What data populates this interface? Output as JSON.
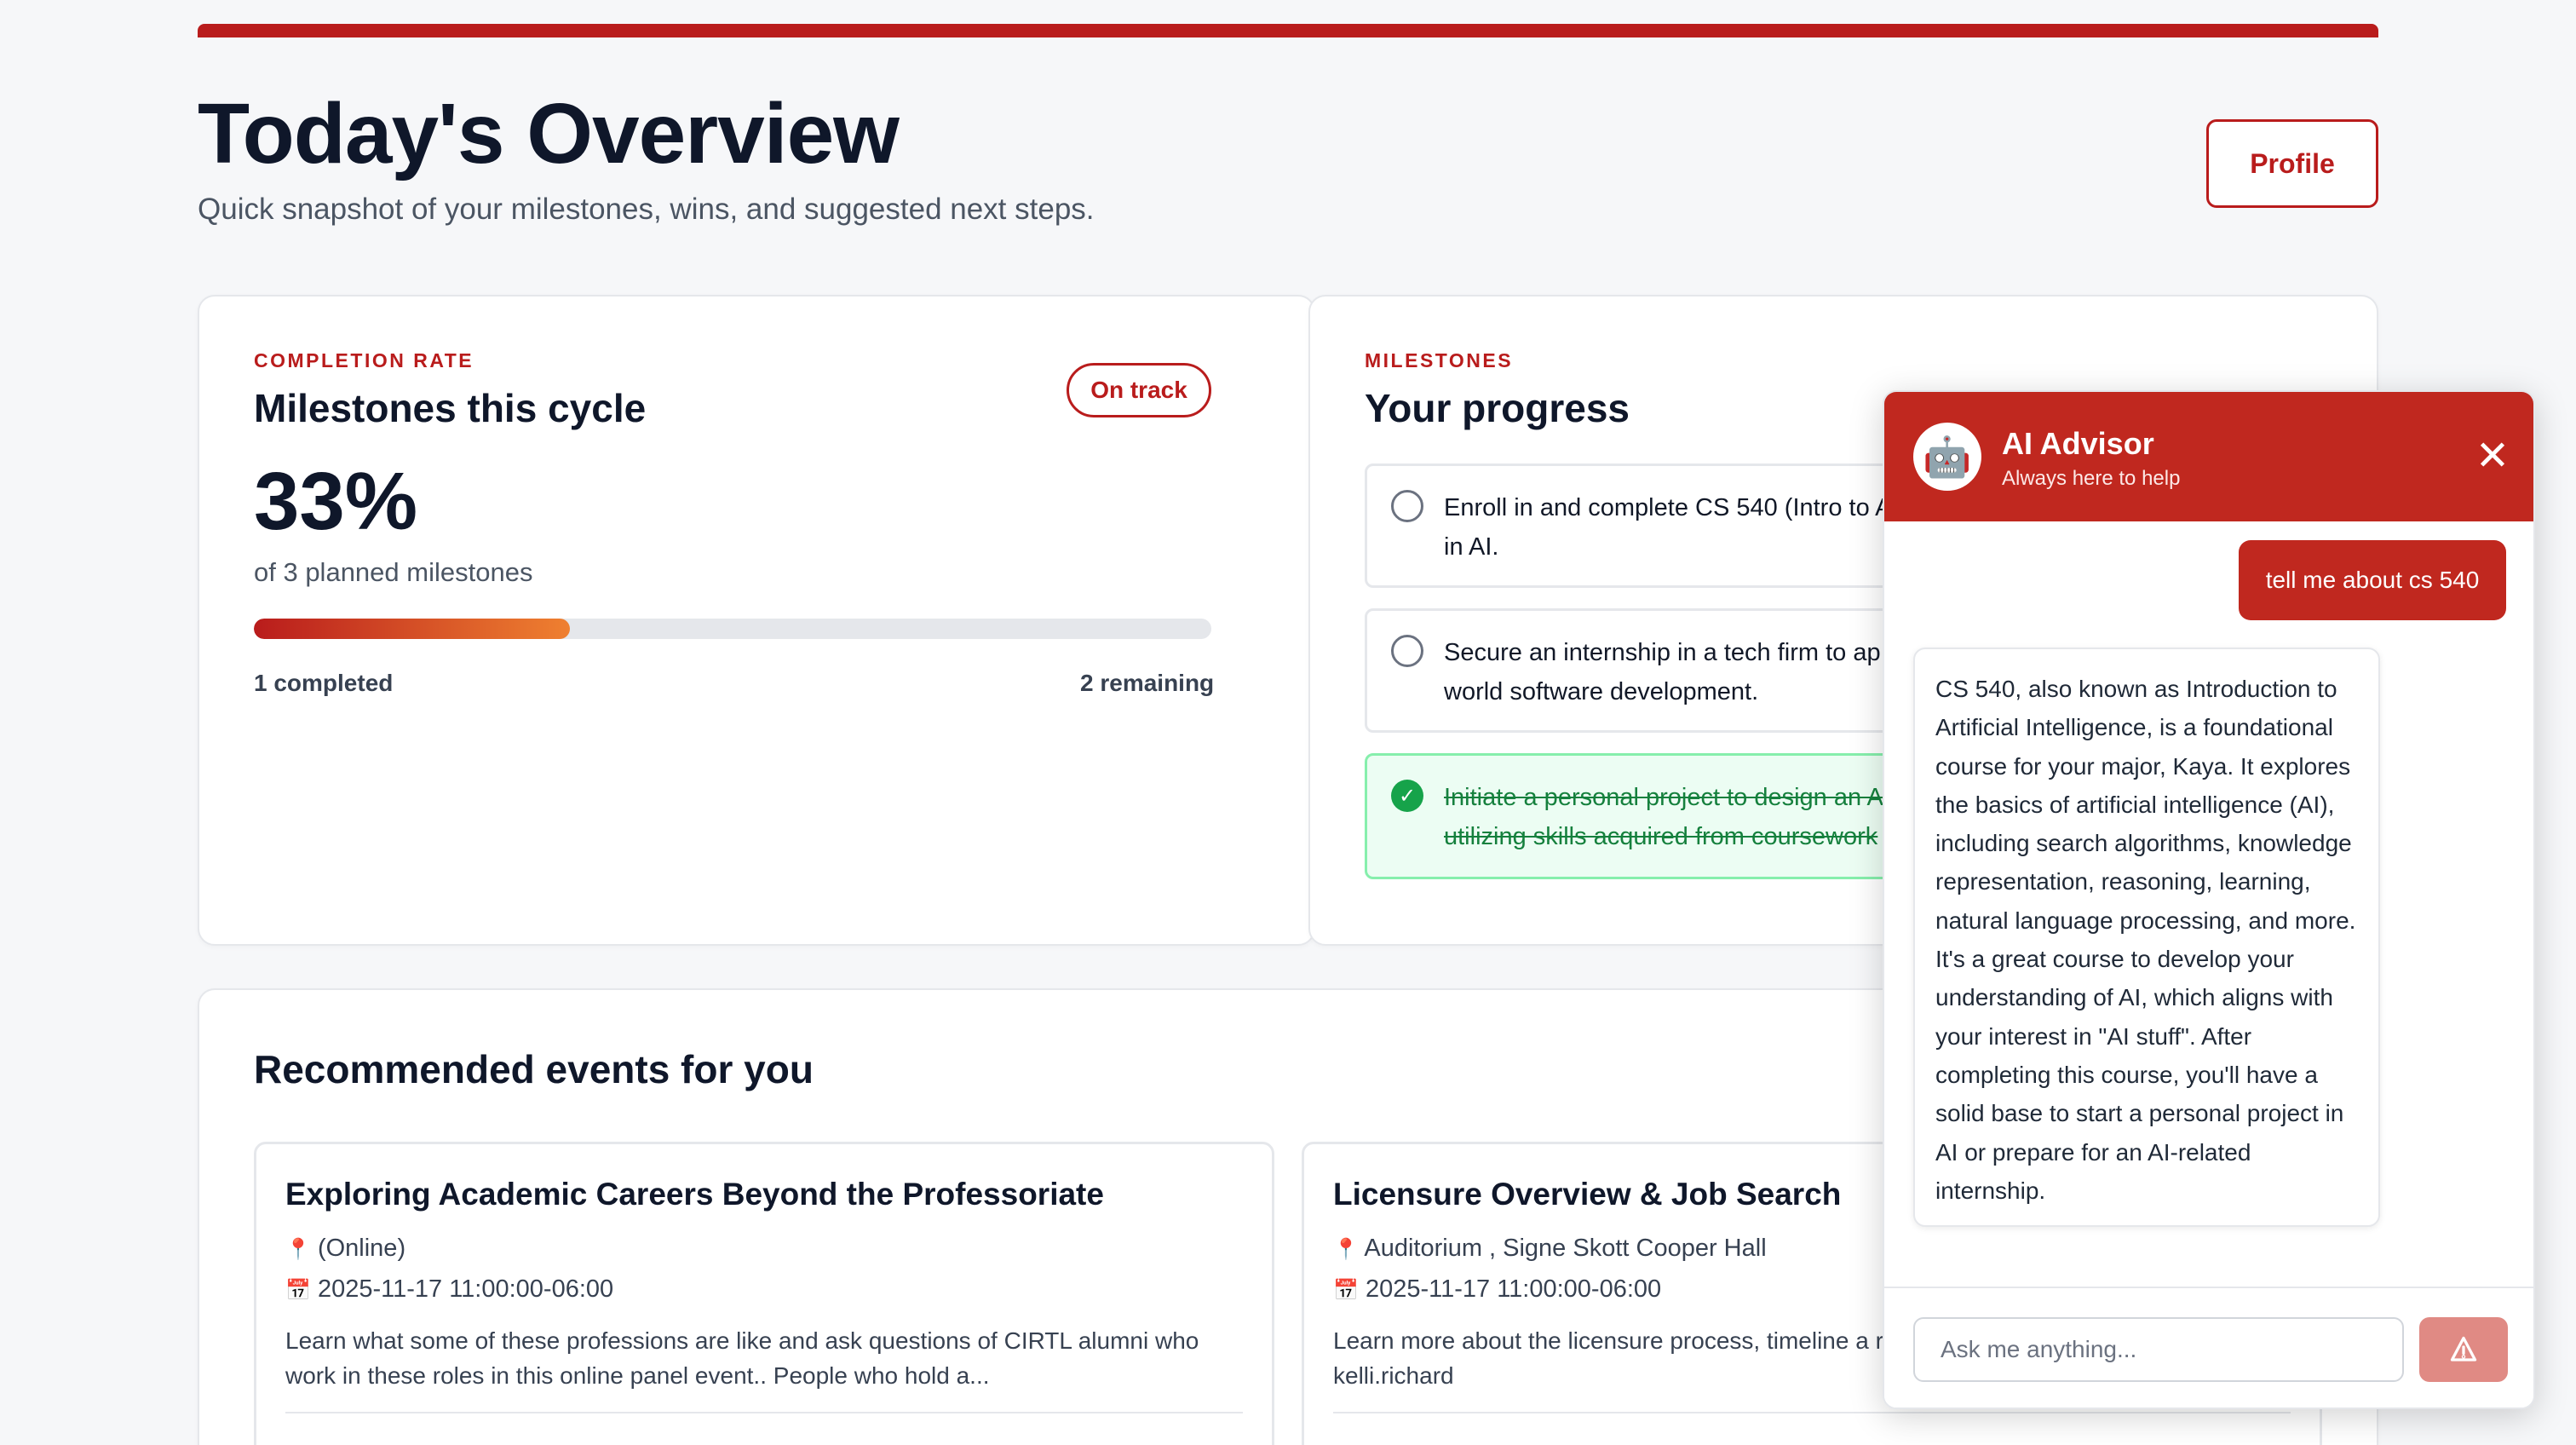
{
  "header": {
    "title": "Today's Overview",
    "subtitle": "Quick snapshot of your milestones, wins, and suggested next steps.",
    "profile_label": "Profile"
  },
  "completion": {
    "eyebrow": "COMPLETION RATE",
    "title": "Milestones this cycle",
    "badge": "On track",
    "percent": "33%",
    "subtitle": "of 3 planned milestones",
    "progress_fraction": 0.33,
    "completed_label": "1 completed",
    "remaining_label": "2 remaining"
  },
  "milestones": {
    "eyebrow": "MILESTONES",
    "title": "Your progress",
    "items": [
      {
        "text": "Enroll in and complete CS 540 (Intro to A",
        "text2": "in AI.",
        "done": false
      },
      {
        "text": "Secure an internship in a tech firm to ap",
        "text2": "world software development.",
        "done": false
      },
      {
        "text": "Initiate a personal project to design an A",
        "text2": "utilizing skills acquired from coursework",
        "done": true
      }
    ]
  },
  "events": {
    "title": "Recommended events for you",
    "items": [
      {
        "title": "Exploring Academic Careers Beyond the Professoriate",
        "location": "(Online)",
        "datetime": "2025-11-17 11:00:00-06:00",
        "description": "Learn what some of these professions are like and ask questions of CIRTL alumni who work in these roles in this online panel event.. People who hold a..."
      },
      {
        "title": "Licensure Overview & Job Search",
        "location": "Auditorium , Signe Skott Cooper Hall",
        "datetime": "2025-11-17 11:00:00-06:00",
        "description": "Learn more about the licensure process, timeline a resources and techniques. CONTACT: kelli.richard"
      }
    ]
  },
  "advisor": {
    "name": "AI Advisor",
    "tagline": "Always here to help",
    "avatar_icon": "robot-icon",
    "user_message": "tell me about cs 540",
    "bot_message": "CS 540, also known as Introduction to Artificial Intelligence, is a foundational course for your major, Kaya. It explores the basics of artificial intelligence (AI), including search algorithms, knowledge representation, reasoning, learning, natural language processing, and more. It's a great course to develop your understanding of AI, which aligns with your interest in \"AI stuff\". After completing this course, you'll have a solid base to start a personal project in AI or prepare for an AI-related internship.",
    "input_placeholder": "Ask me anything...",
    "send_icon": "send-icon"
  },
  "colors": {
    "accent": "#b91c1c",
    "advisor_header": "#c0281f",
    "success": "#16a34a"
  }
}
